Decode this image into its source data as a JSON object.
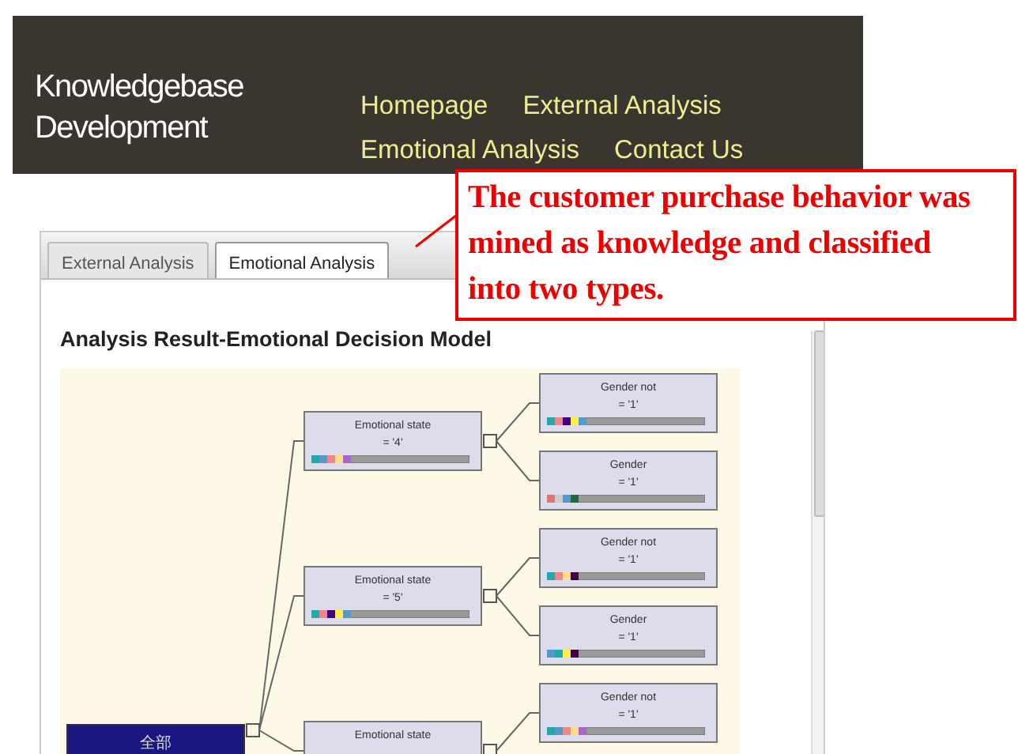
{
  "header": {
    "title": "Knowledgebase Development",
    "nav": [
      {
        "label": "Homepage"
      },
      {
        "label": "External Analysis"
      },
      {
        "label": "Emotional Analysis"
      },
      {
        "label": "Contact Us"
      }
    ]
  },
  "callout": {
    "text": "The customer purchase behavior was mined as knowledge and classified into two types."
  },
  "tabs": [
    {
      "label": "External Analysis",
      "selected": false
    },
    {
      "label": "Emotional Analysis",
      "selected": true
    }
  ],
  "section_title": "Analysis Result-Emotional Decision Model",
  "tree": {
    "label": "全部",
    "children": [
      {
        "label": "Emotional state",
        "condition": "= '4'",
        "children": [
          {
            "label": "Gender not",
            "condition": "= '1'"
          },
          {
            "label": "Gender",
            "condition": "= '1'"
          }
        ]
      },
      {
        "label": "Emotional state",
        "condition": "= '5'",
        "children": [
          {
            "label": "Gender not",
            "condition": "= '1'"
          },
          {
            "label": "Gender",
            "condition": "= '1'"
          }
        ]
      },
      {
        "label": "Emotional state",
        "children": [
          {
            "label": "Gender not",
            "condition": "= '1'"
          }
        ]
      }
    ]
  }
}
